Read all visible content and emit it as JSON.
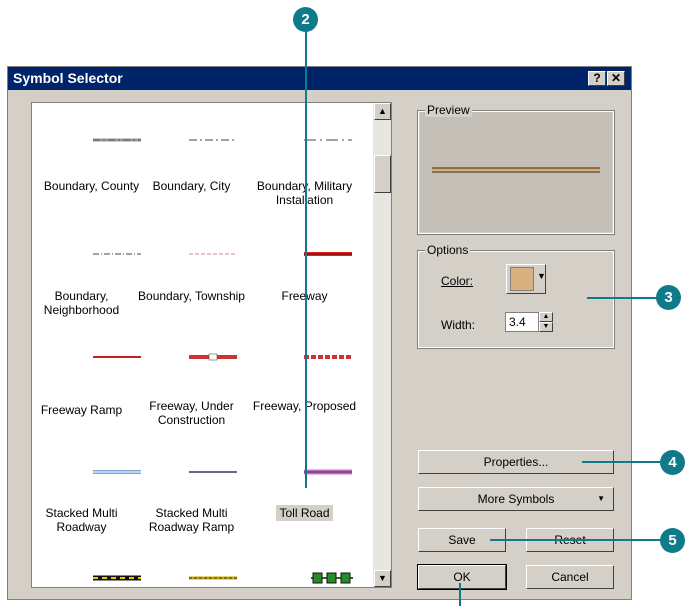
{
  "dialog": {
    "title": "Symbol Selector",
    "help_btn": "?",
    "close_btn": "✕"
  },
  "symbols": [
    {
      "label": "Boundary, County"
    },
    {
      "label": "Boundary, City"
    },
    {
      "label": "Boundary, Military Installation"
    },
    {
      "label": "Boundary, Neighborhood"
    },
    {
      "label": "Boundary, Township"
    },
    {
      "label": "Freeway"
    },
    {
      "label": "Freeway Ramp"
    },
    {
      "label": "Freeway, Under Construction"
    },
    {
      "label": "Freeway, Proposed"
    },
    {
      "label": "Stacked Multi Roadway"
    },
    {
      "label": "Stacked Multi Roadway Ramp"
    },
    {
      "label": "Toll Road",
      "selected": true
    }
  ],
  "preview": {
    "label": "Preview",
    "color": "#d8b080"
  },
  "options": {
    "label": "Options",
    "color_label": "Color:",
    "width_label": "Width:",
    "width_value": "3.4",
    "color_value": "#d8b080"
  },
  "buttons": {
    "properties": "Properties...",
    "more_symbols": "More Symbols",
    "save": "Save",
    "reset": "Reset",
    "ok": "OK",
    "cancel": "Cancel"
  },
  "callouts": {
    "c2": "2",
    "c3": "3",
    "c4": "4",
    "c5": "5"
  },
  "colors": {
    "title_bar": "#00246a",
    "callout": "#0f7b8a",
    "dialog_bg": "#d4d0c8"
  }
}
